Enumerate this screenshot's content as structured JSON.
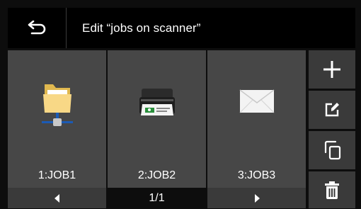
{
  "header": {
    "title": "Edit “jobs on scanner”",
    "back_icon": "back-arrow-icon"
  },
  "jobs": [
    {
      "label": "1:JOB1",
      "icon": "network-folder-icon"
    },
    {
      "label": "2:JOB2",
      "icon": "printer-icon"
    },
    {
      "label": "3:JOB3",
      "icon": "envelope-icon"
    }
  ],
  "pager": {
    "page_text": "1/1",
    "prev_icon": "triangle-left-icon",
    "next_icon": "triangle-right-icon"
  },
  "side_actions": [
    {
      "name": "add",
      "icon": "plus-icon"
    },
    {
      "name": "edit",
      "icon": "edit-icon"
    },
    {
      "name": "copy",
      "icon": "copy-icon"
    },
    {
      "name": "delete",
      "icon": "trash-icon"
    }
  ],
  "colors": {
    "header_bg": "#000000",
    "tile_bg": "#474747",
    "button_bg": "#3a3a3a",
    "folder": "#f5d57a",
    "network_line": "#1b5bb5"
  }
}
